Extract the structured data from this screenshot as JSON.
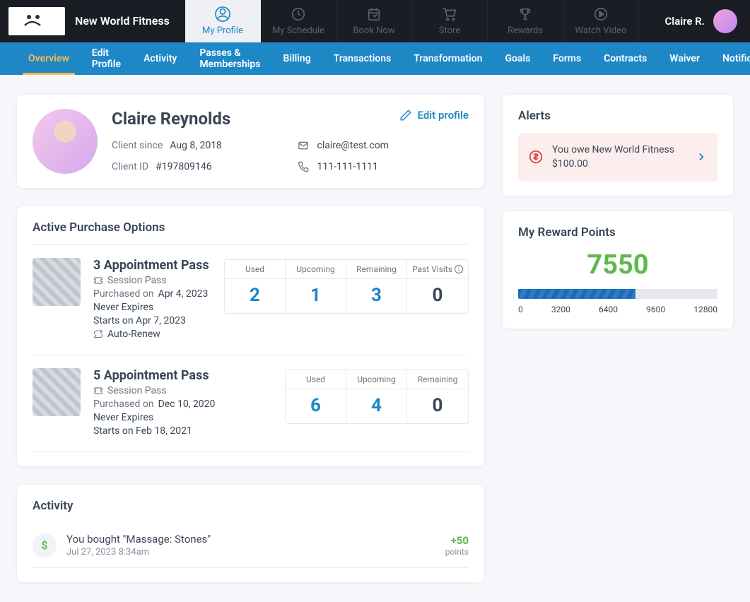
{
  "brand": "New World Fitness",
  "topnav": [
    {
      "label": "My Profile",
      "icon": "profile",
      "active": true
    },
    {
      "label": "My Schedule",
      "icon": "clock",
      "active": false
    },
    {
      "label": "Book Now",
      "icon": "calendar",
      "active": false
    },
    {
      "label": "Store",
      "icon": "cart",
      "active": false
    },
    {
      "label": "Rewards",
      "icon": "trophy",
      "active": false
    },
    {
      "label": "Watch Video",
      "icon": "play",
      "active": false
    }
  ],
  "user_display": "Claire R.",
  "subnav": [
    {
      "label": "Overview",
      "active": true
    },
    {
      "label": "Edit Profile"
    },
    {
      "label": "Activity"
    },
    {
      "label": "Passes & Memberships"
    },
    {
      "label": "Billing"
    },
    {
      "label": "Transactions"
    },
    {
      "label": "Transformation"
    },
    {
      "label": "Goals"
    },
    {
      "label": "Forms"
    },
    {
      "label": "Contracts"
    },
    {
      "label": "Waiver"
    },
    {
      "label": "Notifications"
    }
  ],
  "profile": {
    "name": "Claire Reynolds",
    "edit_label": "Edit profile",
    "since_label": "Client since",
    "since_value": "Aug 8, 2018",
    "id_label": "Client ID",
    "id_value": "#197809146",
    "email": "claire@test.com",
    "phone": "111-111-1111"
  },
  "passes": {
    "title": "Active Purchase Options",
    "headers": {
      "used": "Used",
      "upcoming": "Upcoming",
      "remaining": "Remaining",
      "past": "Past Visits"
    },
    "type_label": "Session Pass",
    "purchased_label": "Purchased on",
    "autorenew_label": "Auto-Renew",
    "items": [
      {
        "title": "3 Appointment Pass",
        "purchased": "Apr 4, 2023",
        "expires": "Never Expires",
        "starts": "Starts on Apr 7, 2023",
        "autorenew": true,
        "used": "2",
        "upcoming": "1",
        "remaining": "3",
        "past": "0",
        "show_past": true
      },
      {
        "title": "5 Appointment Pass",
        "purchased": "Dec 10, 2020",
        "expires": "Never Expires",
        "starts": "Starts on Feb 18, 2021",
        "autorenew": false,
        "used": "6",
        "upcoming": "4",
        "remaining": "0",
        "show_past": false
      }
    ]
  },
  "activity": {
    "title": "Activity",
    "items": [
      {
        "icon": "$",
        "text": "You bought \"Massage: Stones\"",
        "time": "Jul 27, 2023 8:34am",
        "points": "+50",
        "points_label": "points"
      }
    ]
  },
  "alerts": {
    "title": "Alerts",
    "text": "You owe New World Fitness $100.00"
  },
  "rewards": {
    "title": "My Reward Points",
    "value": "7550",
    "scale": [
      "0",
      "3200",
      "6400",
      "9600",
      "12800"
    ],
    "fill_pct": 59
  }
}
